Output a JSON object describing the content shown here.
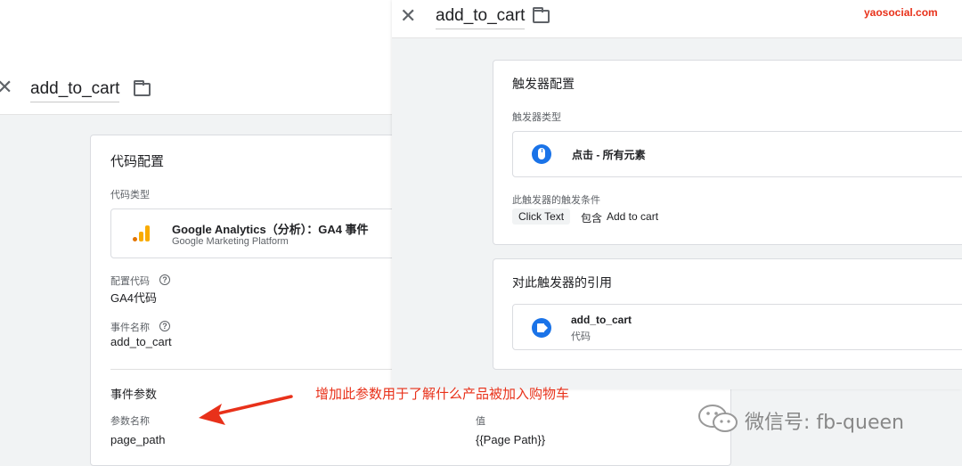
{
  "tag_panel": {
    "title": "add_to_cart",
    "card_title": "代码配置",
    "tag_type_label": "代码类型",
    "tag_type_name": "Google Analytics（分析）：GA4 事件",
    "tag_type_vendor": "Google Marketing Platform",
    "config_tag_label": "配置代码",
    "config_tag_value": "GA4代码",
    "event_name_label": "事件名称",
    "event_name_value": "add_to_cart",
    "event_params_title": "事件参数",
    "param_name_header": "参数名称",
    "param_value_header": "值",
    "param_name": "page_path",
    "param_value": "{{Page Path}}"
  },
  "trigger_panel": {
    "title": "add_to_cart",
    "card_title": "触发器配置",
    "trigger_type_label": "触发器类型",
    "trigger_type_name": "点击 - 所有元素",
    "conditions_label": "此触发器的触发条件",
    "condition_variable": "Click Text",
    "condition_operator": "包含",
    "condition_value": "Add to cart",
    "references_title": "对此触发器的引用",
    "reference_name": "add_to_cart",
    "reference_type": "代码"
  },
  "annotations": {
    "arrow_note": "增加此参数用于了解什么产品被加入购物车",
    "watermark": "yaosocial.com",
    "wechat": "微信号: fb-queen"
  },
  "icons": {
    "close": "close-icon",
    "folder": "folder-icon",
    "help": "help-icon",
    "analytics": "analytics-icon",
    "mouse": "mouse-click-icon",
    "tag": "tag-icon",
    "wechat": "wechat-icon",
    "arrow": "red-arrow-icon"
  },
  "colors": {
    "accent_blue": "#1a73e8",
    "ga_orange": "#f9ab00",
    "ga_dark_orange": "#e37400",
    "annotation_red": "#e8311a",
    "background_grey": "#f1f3f4"
  }
}
